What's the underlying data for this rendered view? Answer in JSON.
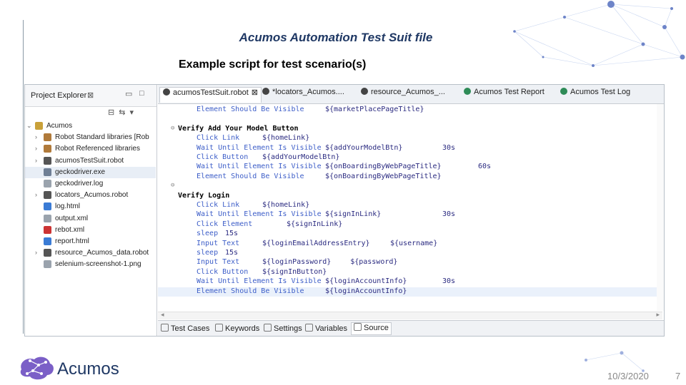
{
  "slide": {
    "title": "Acumos Automation Test Suit file",
    "subtitle": "Example script for test scenario(s)",
    "date": "10/3/2020",
    "page_number": "7",
    "logo_text": "Acumos"
  },
  "explorer": {
    "tab_label": "Project Explorer",
    "tab_close": "⊠",
    "items": [
      {
        "label": "Acumos",
        "arrow": "⌄",
        "icon_color": "#c9a13a"
      },
      {
        "label": "Robot Standard libraries [Rob",
        "arrow": "›",
        "icon_color": "#b07a3a"
      },
      {
        "label": "Robot Referenced libraries",
        "arrow": "›",
        "icon_color": "#b07a3a"
      },
      {
        "label": "acumosTestSuit.robot",
        "arrow": "›",
        "icon_color": "#555555"
      },
      {
        "label": "geckodriver.exe",
        "arrow": "",
        "icon_color": "#6f7f95"
      },
      {
        "label": "geckodriver.log",
        "arrow": "",
        "icon_color": "#9aa3ad"
      },
      {
        "label": "locators_Acumos.robot",
        "arrow": "›",
        "icon_color": "#555555"
      },
      {
        "label": "log.html",
        "arrow": "",
        "icon_color": "#3a7bd5"
      },
      {
        "label": "output.xml",
        "arrow": "",
        "icon_color": "#9aa3ad"
      },
      {
        "label": "rebot.xml",
        "arrow": "",
        "icon_color": "#cc3333"
      },
      {
        "label": "report.html",
        "arrow": "",
        "icon_color": "#3a7bd5"
      },
      {
        "label": "resource_Acumos_data.robot",
        "arrow": "›",
        "icon_color": "#555555"
      },
      {
        "label": "selenium-screenshot-1.png",
        "arrow": "",
        "icon_color": "#9aa3ad"
      }
    ]
  },
  "editor": {
    "tabs": [
      {
        "label": "acumosTestSuit.robot",
        "close": "⊠",
        "icon_color": "#444444"
      },
      {
        "label": "*locators_Acumos....",
        "close": "",
        "icon_color": "#444444"
      },
      {
        "label": "resource_Acumos_...",
        "close": "",
        "icon_color": "#444444"
      },
      {
        "label": "Acumos Test Report",
        "close": "",
        "icon_color": "#2e8b57"
      },
      {
        "label": "Acumos Test Log",
        "close": "",
        "icon_color": "#2e8b57"
      }
    ],
    "lines": [
      {
        "fold": "",
        "testcase": "",
        "kw": "Element Should Be Visible",
        "a1": "${marketPlacePageTitle}",
        "a2": ""
      },
      {
        "fold": "",
        "testcase": "",
        "kw": "",
        "a1": "",
        "a2": ""
      },
      {
        "fold": "⊖",
        "testcase": "Verify Add Your Model Button",
        "kw": "",
        "a1": "",
        "a2": ""
      },
      {
        "fold": "",
        "testcase": "",
        "kw": "Click Link",
        "a1": "${homeLink}",
        "a2": ""
      },
      {
        "fold": "",
        "testcase": "",
        "kw": "Wait Until Element Is Visible",
        "a1": "${addYourModelBtn}",
        "a2": "30s"
      },
      {
        "fold": "",
        "testcase": "",
        "kw": "Click Button",
        "a1": "${addYourModelBtn}",
        "a2": ""
      },
      {
        "fold": "",
        "testcase": "",
        "kw": "Wait Until Element Is Visible",
        "a1": "${onBoardingByWebPageTitle}",
        "a2": "60s"
      },
      {
        "fold": "",
        "testcase": "",
        "kw": "Element Should Be Visible",
        "a1": "${onBoardingByWebPageTitle}",
        "a2": ""
      },
      {
        "fold": "⊖",
        "testcase": "",
        "kw": "",
        "a1": "",
        "a2": ""
      },
      {
        "fold": "",
        "testcase": "Verify Login",
        "kw": "",
        "a1": "",
        "a2": ""
      },
      {
        "fold": "",
        "testcase": "",
        "kw": "Click Link",
        "a1": "${homeLink}",
        "a2": ""
      },
      {
        "fold": "",
        "testcase": "",
        "kw": "Wait Until Element Is Visible",
        "a1": "${signInLink}",
        "a2": "30s"
      },
      {
        "fold": "",
        "testcase": "",
        "kw": "Click Element",
        "a1": "${signInLink}",
        "a2": ""
      },
      {
        "fold": "",
        "testcase": "",
        "kw": "sleep",
        "a1": "15s",
        "a2": ""
      },
      {
        "fold": "",
        "testcase": "",
        "kw": "Input Text",
        "a1": "${loginEmailAddressEntry}",
        "a2": "${username}"
      },
      {
        "fold": "",
        "testcase": "",
        "kw": "sleep",
        "a1": "15s",
        "a2": ""
      },
      {
        "fold": "",
        "testcase": "",
        "kw": "Input Text",
        "a1": "${loginPassword}",
        "a2": "${password}"
      },
      {
        "fold": "",
        "testcase": "",
        "kw": "Click Button",
        "a1": "${signInButton}",
        "a2": ""
      },
      {
        "fold": "",
        "testcase": "",
        "kw": "Wait Until Element Is Visible",
        "a1": "${loginAccountInfo}",
        "a2": "30s"
      },
      {
        "fold": "",
        "testcase": "",
        "kw": "Element Should Be Visible",
        "a1": "${loginAccountInfo}",
        "a2": ""
      }
    ],
    "bottom_tabs": [
      {
        "label": "Test Cases"
      },
      {
        "label": "Keywords"
      },
      {
        "label": "Settings"
      },
      {
        "label": "Variables"
      },
      {
        "label": "Source"
      }
    ]
  }
}
